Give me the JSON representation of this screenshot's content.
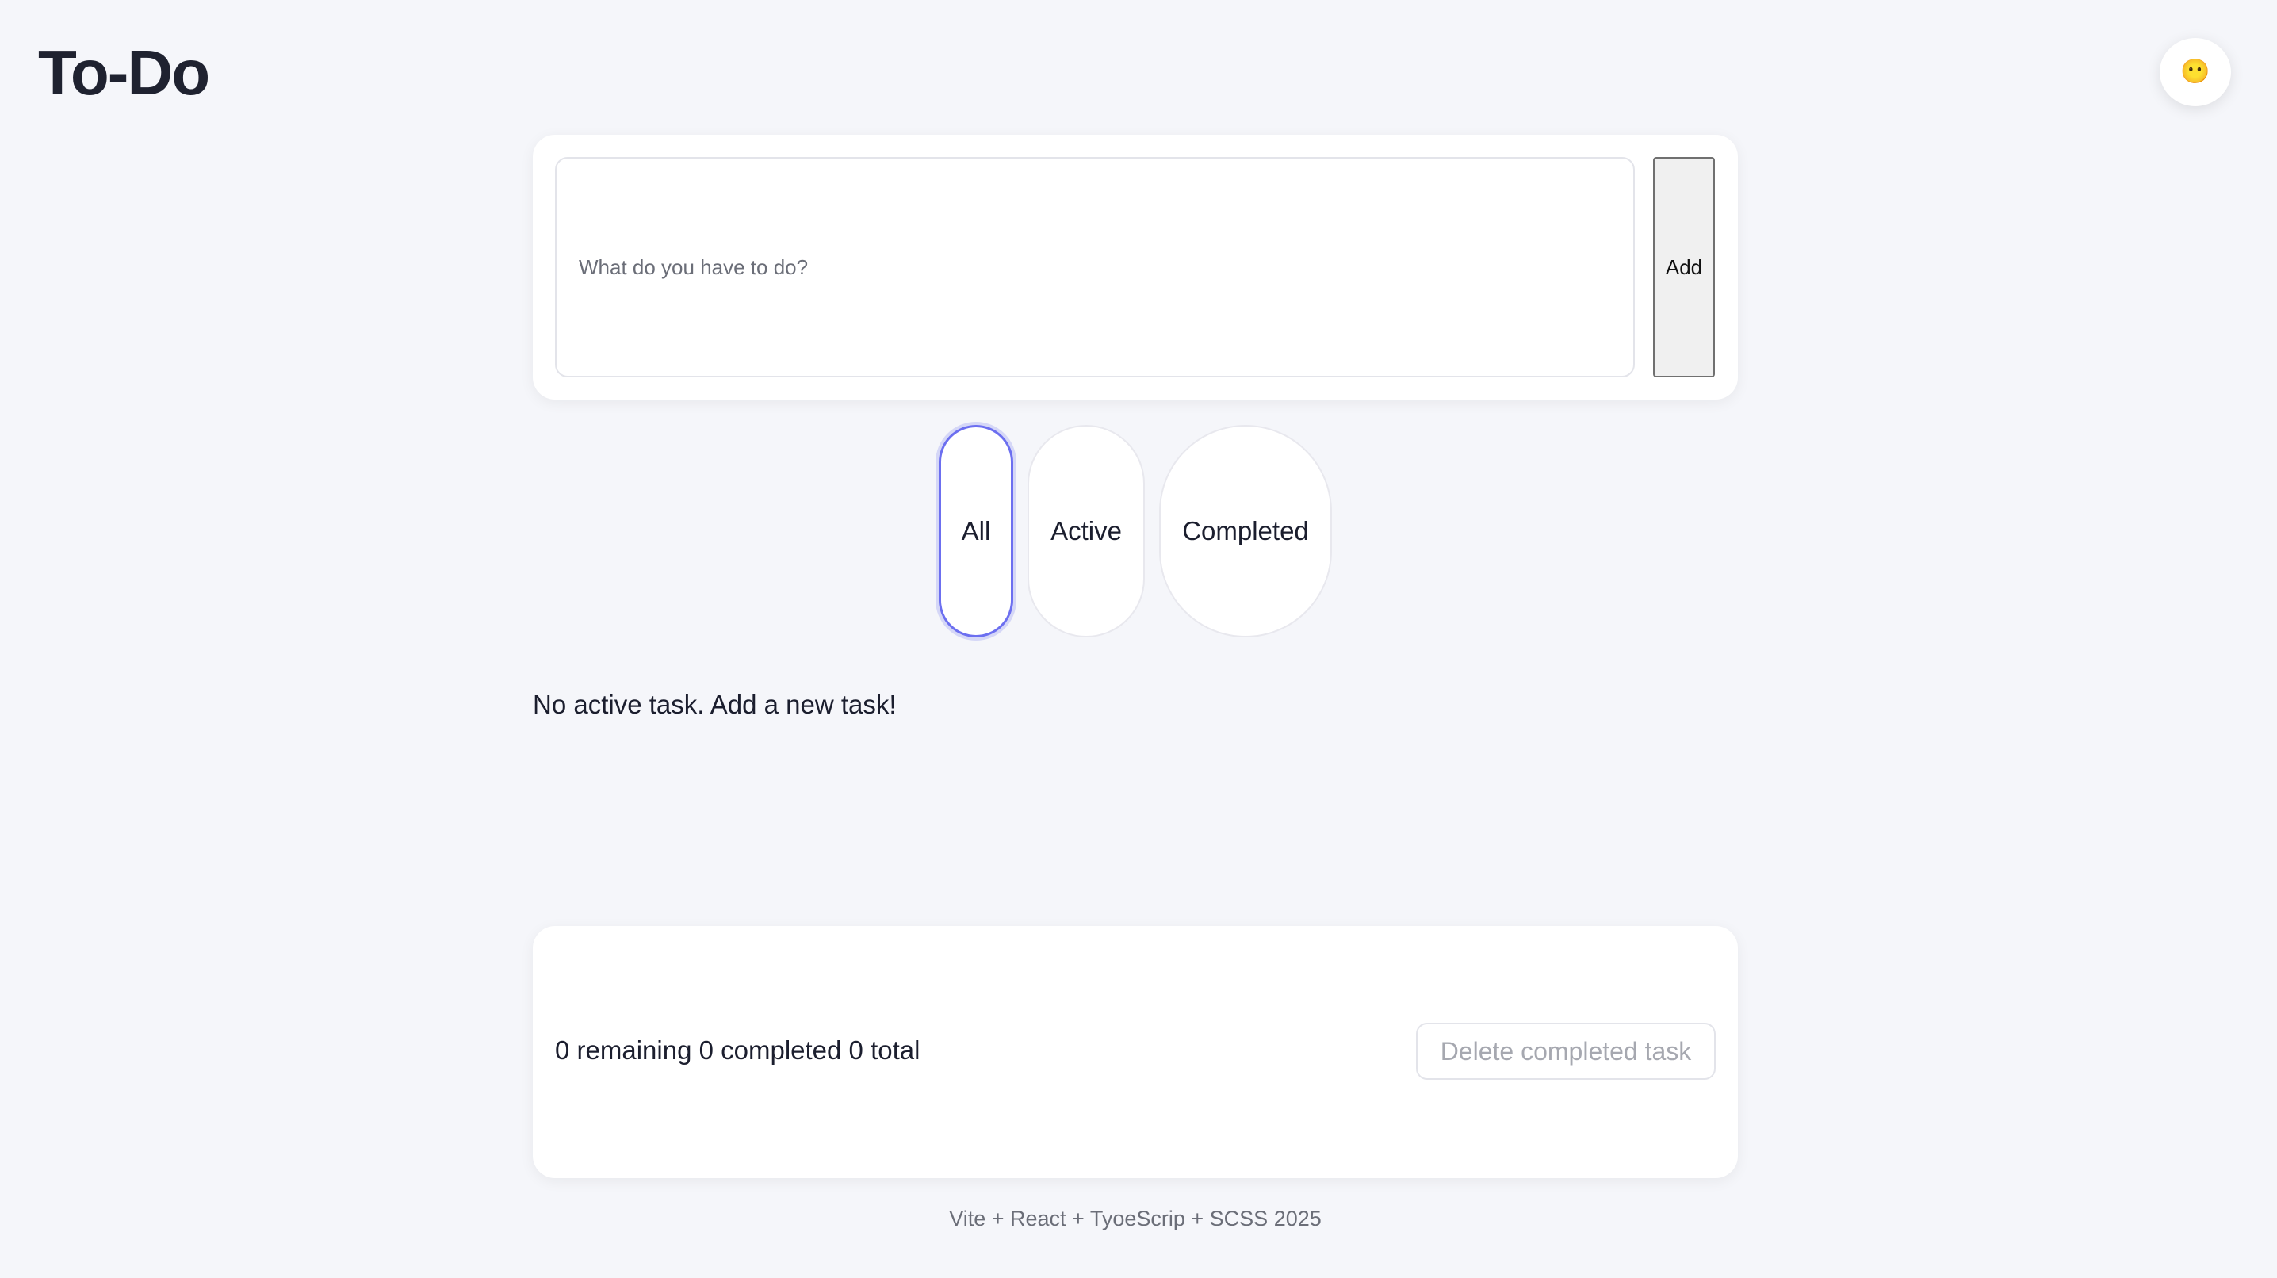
{
  "header": {
    "title": "To-Do",
    "theme_toggle_icon": "😶"
  },
  "input": {
    "placeholder": "What do you have to do?",
    "value": "",
    "add_label": "Add"
  },
  "filters": {
    "selected": "All",
    "items": [
      {
        "label": "All"
      },
      {
        "label": "Active"
      },
      {
        "label": "Completed"
      }
    ]
  },
  "tasks": {
    "items": [],
    "empty_message": "No active task. Add a new task!"
  },
  "stats": {
    "summary": "0 remaining 0 completed 0 total",
    "delete_completed_label": "Delete completed task"
  },
  "footer": {
    "text": "Vite + React + TyoeScrip + SCSS 2025"
  },
  "colors": {
    "background": "#f5f6fa",
    "accent": "#6c6ff0",
    "text": "#1b1e2e"
  }
}
